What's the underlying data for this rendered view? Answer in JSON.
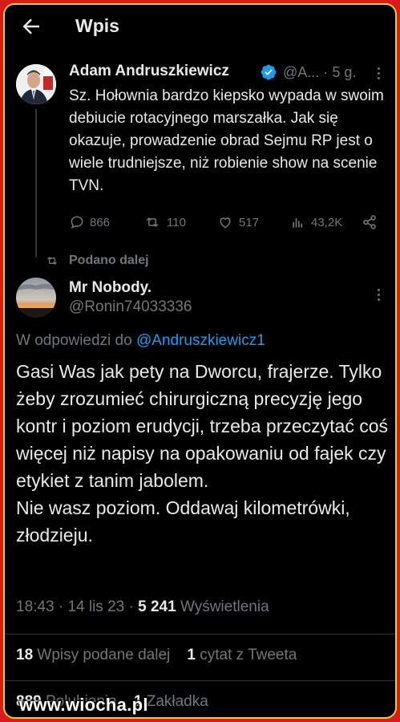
{
  "header": {
    "title": "Wpis"
  },
  "original_post": {
    "author_name": "Adam Andruszkiewicz",
    "author_handle": "@A...",
    "separator": "·",
    "time_ago": "5 g.",
    "text": "Sz. Hołownia bardzo kiepsko wypada w swoim debiucie rotacyjnego marszałka. Jak się okazuje, prowadzenie obrad Sejmu RP jest o wiele trudniejsze, niż robienie show na scenie TVN.",
    "replies": "866",
    "reposts": "110",
    "likes": "517",
    "views": "43,2K"
  },
  "repost_label": "Podano dalej",
  "reply_post": {
    "author_name": "Mr Nobody.",
    "author_handle": "@Ronin74033336",
    "reply_to_prefix": "W odpowiedzi do ",
    "reply_to_handle": "@Andruszkiewicz1",
    "text": "Gasi Was jak pety na Dworcu, frajerze. Tylko żeby zrozumieć chirurgiczną precyzję jego kontr i poziom erudycji, trzeba przeczytać coś więcej niż napisy na opakowaniu od fajek czy etykiet z tanim jabolem.\nNie wasz poziom. Oddawaj kilometrówki, złodzieju.",
    "time": "18:43",
    "date": "14 lis 23",
    "views_count": "5 241",
    "views_label": "Wyświetlenia",
    "reposts_count": "18",
    "reposts_label": "Wpisy podane dalej",
    "quotes_count": "1",
    "quotes_label": "cytat z Tweeta",
    "likes_count": "889",
    "likes_label": "Polubienia",
    "bookmarks_count": "1",
    "bookmarks_label": "Zakładka"
  },
  "watermark": "www.wiocha.pl",
  "colors": {
    "background": "#000000",
    "text": "#e7e9ea",
    "muted": "#71767b",
    "link": "#1d9bf0",
    "frame_outer": "#d81b1b",
    "frame_inner": "#e9d21e"
  }
}
